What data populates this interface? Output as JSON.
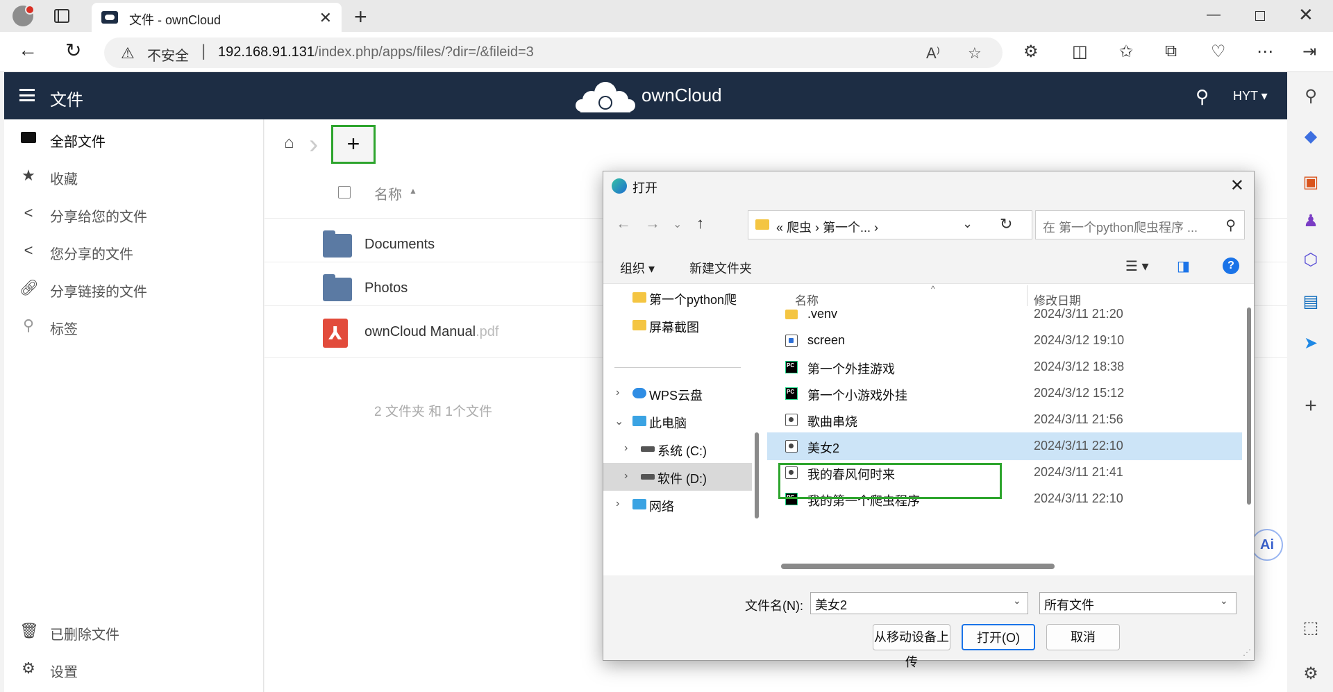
{
  "browser": {
    "tab_title": "文件 - ownCloud",
    "tab_close": "✕",
    "new_tab": "+",
    "insecure_label": "不安全",
    "url_host": "192.168.91.131",
    "url_path": "/index.php/apps/files/?dir=/&fileid=3",
    "window_min": "—",
    "window_close": "✕"
  },
  "owncloud": {
    "app_title": "文件",
    "brand": "ownCloud",
    "user": "HYT ▾",
    "sidebar": {
      "items": [
        {
          "label": "全部文件",
          "icon": "folder-icon"
        },
        {
          "label": "收藏",
          "icon": "star-icon"
        },
        {
          "label": "分享给您的文件",
          "icon": "share-icon"
        },
        {
          "label": "您分享的文件",
          "icon": "share-icon"
        },
        {
          "label": "分享链接的文件",
          "icon": "link-icon"
        },
        {
          "label": "标签",
          "icon": "tag-search-icon"
        }
      ],
      "bottom": [
        {
          "label": "已删除文件",
          "icon": "trash-icon"
        },
        {
          "label": "设置",
          "icon": "gear-icon"
        }
      ]
    },
    "new_button": "+",
    "column_name": "名称",
    "files": [
      {
        "name": "Documents",
        "ext": "",
        "type": "folder"
      },
      {
        "name": "Photos",
        "ext": "",
        "type": "folder"
      },
      {
        "name": "ownCloud Manual",
        "ext": ".pdf",
        "type": "pdf"
      }
    ],
    "summary": "2 文件夹 和 1个文件"
  },
  "dialog": {
    "title": "打开",
    "close": "✕",
    "path": "«  爬虫  ›  第一个...  ›",
    "search_placeholder": "在 第一个python爬虫程序 ...",
    "toolbar": {
      "organize": "组织 ▾",
      "new_folder": "新建文件夹"
    },
    "tree": [
      {
        "label": "第一个python爬",
        "icon": "folder-icon"
      },
      {
        "label": "屏幕截图",
        "icon": "folder-icon"
      },
      {
        "label": "WPS云盘",
        "icon": "cloud-icon"
      },
      {
        "label": "此电脑",
        "icon": "computer-icon"
      },
      {
        "label": "系统 (C:)",
        "icon": "drive-icon"
      },
      {
        "label": "软件 (D:)",
        "icon": "drive-icon"
      },
      {
        "label": "网络",
        "icon": "network-icon"
      }
    ],
    "columns": {
      "name": "名称",
      "date": "修改日期"
    },
    "files": [
      {
        "name": ".venv",
        "date": "2024/3/11 21:20",
        "type": "folder"
      },
      {
        "name": "screen",
        "date": "2024/3/12 19:10",
        "type": "doc"
      },
      {
        "name": "第一个外挂游戏",
        "date": "2024/3/12 18:38",
        "type": "pycharm"
      },
      {
        "name": "第一个小游戏外挂",
        "date": "2024/3/12 15:12",
        "type": "pycharm"
      },
      {
        "name": "歌曲串烧",
        "date": "2024/3/11 21:56",
        "type": "video"
      },
      {
        "name": "美女2",
        "date": "2024/3/11 22:10",
        "type": "video",
        "selected": true
      },
      {
        "name": "我的春风何时来",
        "date": "2024/3/11 21:41",
        "type": "video"
      },
      {
        "name": "我的第一个爬虫程序",
        "date": "2024/3/11 22:10",
        "type": "pycharm"
      }
    ],
    "filename_label": "文件名(N):",
    "filename_value": "美女2",
    "filetype_value": "所有文件",
    "buttons": {
      "upload_mobile": "从移动设备上传",
      "open": "打开(O)",
      "cancel": "取消"
    }
  }
}
